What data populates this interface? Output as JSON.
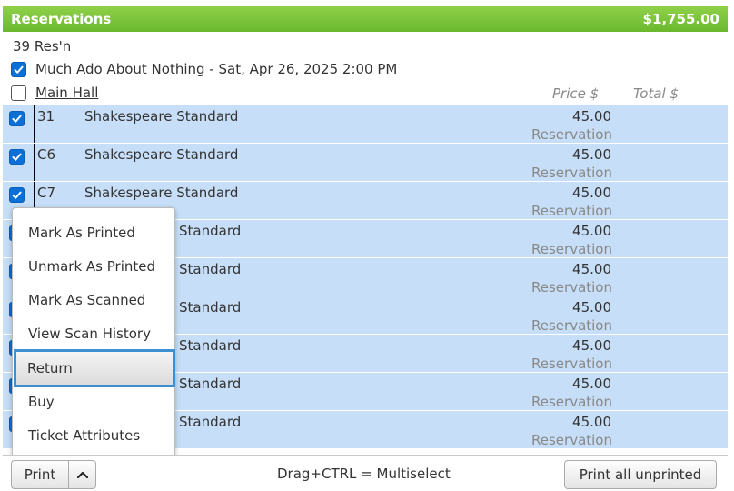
{
  "header": {
    "title": "Reservations",
    "total": "$1,755.00"
  },
  "summary": {
    "count": "39 Res'n"
  },
  "event": {
    "label": "Much Ado About Nothing - Sat, Apr 26, 2025 2:00 PM",
    "checked": true
  },
  "section": {
    "label": "Main Hall",
    "checked": false,
    "price_header": "Price $",
    "total_header": "Total $"
  },
  "seats": [
    {
      "code": "31",
      "name": "Shakespeare Standard",
      "price": "45.00",
      "type": "Reservation",
      "checked": true
    },
    {
      "code": "C6",
      "name": "Shakespeare Standard",
      "price": "45.00",
      "type": "Reservation",
      "checked": true
    },
    {
      "code": "C7",
      "name": "Shakespeare Standard",
      "price": "45.00",
      "type": "Reservation",
      "checked": true
    },
    {
      "code": "",
      "name": "Standard",
      "price": "45.00",
      "type": "Reservation",
      "checked": true
    },
    {
      "code": "",
      "name": "Standard",
      "price": "45.00",
      "type": "Reservation",
      "checked": true
    },
    {
      "code": "",
      "name": "Standard",
      "price": "45.00",
      "type": "Reservation",
      "checked": true
    },
    {
      "code": "",
      "name": "Standard",
      "price": "45.00",
      "type": "Reservation",
      "checked": true
    },
    {
      "code": "",
      "name": "Standard",
      "price": "45.00",
      "type": "Reservation",
      "checked": true
    },
    {
      "code": "",
      "name": "Standard",
      "price": "45.00",
      "type": "Reservation",
      "checked": true
    }
  ],
  "menu": {
    "items": [
      {
        "label": "Mark As Printed"
      },
      {
        "label": "Unmark As Printed"
      },
      {
        "label": "Mark As Scanned"
      },
      {
        "label": "View Scan History"
      },
      {
        "label": "Return",
        "selected": true
      },
      {
        "label": "Buy"
      },
      {
        "label": "Ticket Attributes"
      }
    ]
  },
  "footer": {
    "print_label": "Print",
    "toggle_icon": "chevron-up-icon",
    "hint": "Drag+CTRL = Multiselect",
    "print_all_label": "Print all unprinted"
  },
  "colors": {
    "header": "#7cc43a",
    "selected_row": "#c6def7",
    "checkbox": "#0a6fd6",
    "menu_highlight": "#3c8fd0"
  }
}
